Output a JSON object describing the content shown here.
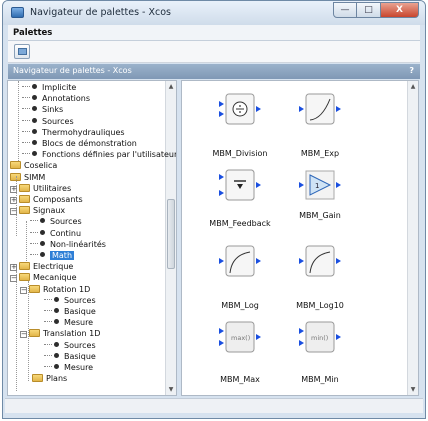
{
  "window": {
    "title": "Navigateur de palettes - Xcos",
    "buttons": {
      "minimize": "—",
      "maximize": "□",
      "close": "X"
    }
  },
  "menubar": {
    "items": [
      "Palettes"
    ]
  },
  "panel": {
    "title": "Navigateur de palettes - Xcos",
    "help": "?"
  },
  "tree": {
    "items": [
      "Implicite",
      "Annotations",
      "Sinks",
      "Sources",
      "Thermohydrauliques",
      "Blocs de démonstration",
      "Fonctions définies par l'utilisateur",
      "Coselica",
      "SIMM",
      "Utilitaires",
      "Composants",
      "Signaux",
      "Sources",
      "Continu",
      "Non-linéarités",
      "Math",
      "Electrique",
      "Mecanique",
      "Rotation 1D",
      "Sources",
      "Basique",
      "Mesure",
      "Translation 1D",
      "Sources",
      "Basique",
      "Mesure",
      "Plans"
    ],
    "selected": "Math",
    "expander_plus": "+",
    "expander_minus": "−"
  },
  "palette": {
    "blocks": [
      {
        "label": "MBM_Division",
        "icon": "division-block-icon"
      },
      {
        "label": "MBM_Exp",
        "icon": "exp-block-icon"
      },
      {
        "label": "MBM_Feedback",
        "icon": "feedback-block-icon"
      },
      {
        "label": "MBM_Gain",
        "icon": "gain-block-icon",
        "symbol": "1"
      },
      {
        "label": "MBM_Log",
        "icon": "log-block-icon"
      },
      {
        "label": "MBM_Log10",
        "icon": "log10-block-icon"
      },
      {
        "label": "MBM_Max",
        "icon": "max-block-icon",
        "symbol": "max()"
      },
      {
        "label": "MBM_Min",
        "icon": "min-block-icon",
        "symbol": "min()"
      }
    ]
  },
  "scroll": {
    "up": "▲",
    "down": "▼"
  }
}
